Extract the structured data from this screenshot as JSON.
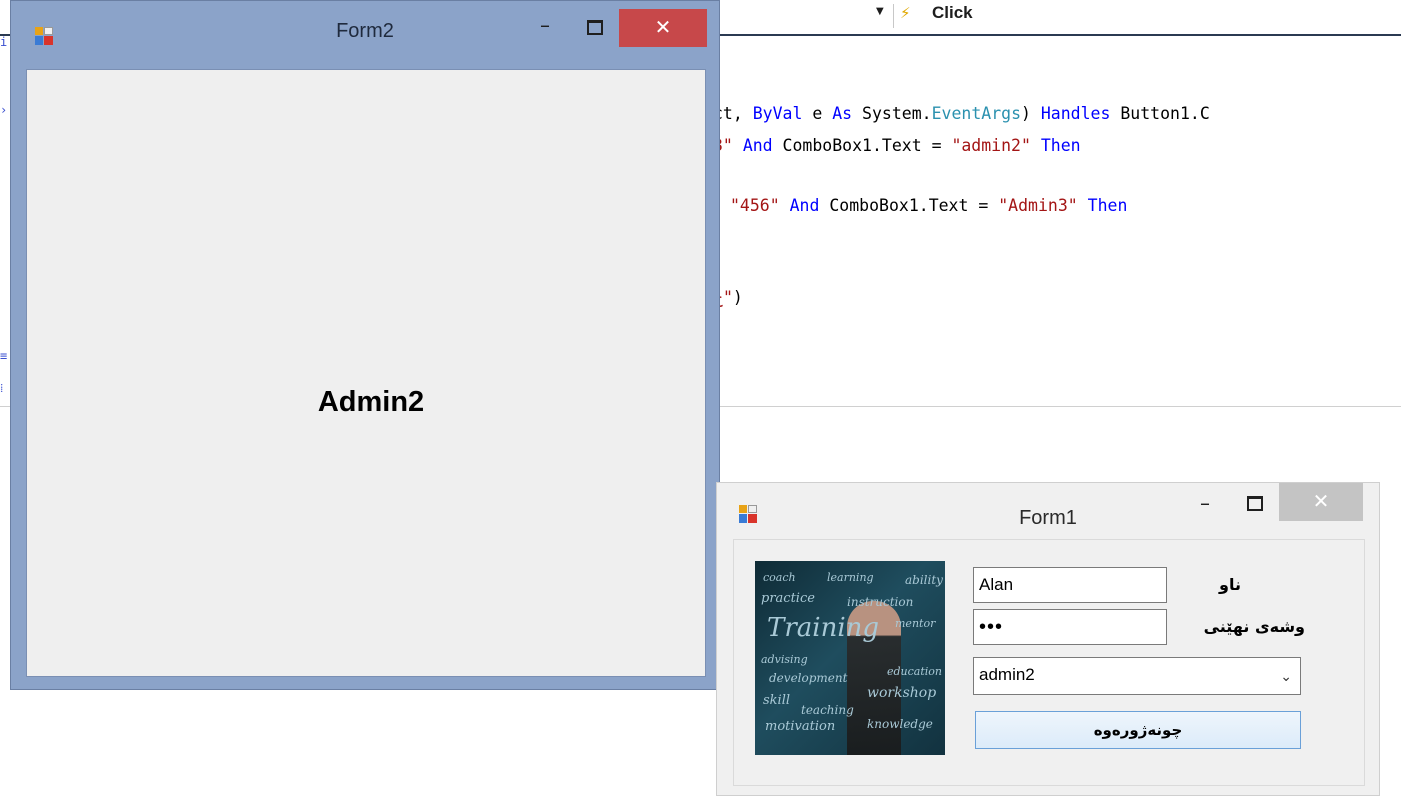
{
  "ide": {
    "event_selector": "Click",
    "code_lines": [
      {
        "parts": [
          {
            "t": "ct, ",
            "c": ""
          },
          {
            "t": "ByVal",
            "c": "kw"
          },
          {
            "t": " e ",
            "c": ""
          },
          {
            "t": "As",
            "c": "kw"
          },
          {
            "t": " System.",
            "c": ""
          },
          {
            "t": "EventArgs",
            "c": "ty"
          },
          {
            "t": ") ",
            "c": ""
          },
          {
            "t": "Handles",
            "c": "kw"
          },
          {
            "t": " Button1.C",
            "c": ""
          }
        ]
      },
      {
        "parts": [
          {
            "t": "3\" ",
            "c": "st"
          },
          {
            "t": "And",
            "c": "kw"
          },
          {
            "t": " ComboBox1.Text = ",
            "c": ""
          },
          {
            "t": "\"admin2\"",
            "c": "st"
          },
          {
            "t": " ",
            "c": ""
          },
          {
            "t": "Then",
            "c": "kw"
          }
        ]
      },
      {
        "parts": [
          {
            "t": "\"456\"",
            "c": "st"
          },
          {
            "t": " ",
            "c": ""
          },
          {
            "t": "And",
            "c": "kw"
          },
          {
            "t": " ComboBox1.Text = ",
            "c": ""
          },
          {
            "t": "\"Admin3\"",
            "c": "st"
          },
          {
            "t": " ",
            "c": ""
          },
          {
            "t": "Then",
            "c": "kw"
          }
        ]
      },
      {
        "parts": [
          {
            "t": "ج\"",
            "c": "st"
          },
          {
            "t": ")",
            "c": ""
          }
        ]
      }
    ]
  },
  "form2": {
    "title": "Form2",
    "label": "Admin2",
    "minimize": "–",
    "close": "✕"
  },
  "form1": {
    "title": "Form1",
    "minimize": "–",
    "close": "✕",
    "username_label": "ناو",
    "username_value": "Alan",
    "password_label": "وشەی نهێنی",
    "password_value": "•••",
    "combo_value": "admin2",
    "combo_arrow": "⌄",
    "login_button": "چونەژورەوە",
    "photo_words": [
      "coach",
      "learning",
      "ability",
      "practice",
      "instruction",
      "Training",
      "mentor",
      "advising",
      "development",
      "education",
      "skill",
      "teaching",
      "workshop",
      "motivation",
      "knowledge"
    ]
  },
  "colors": {
    "form2_chrome": "#8ba3c9",
    "close_active": "#c7484a",
    "close_inactive": "#c4c4c4",
    "keyword": "#0000ff",
    "string": "#a31515",
    "type": "#2b91af"
  }
}
